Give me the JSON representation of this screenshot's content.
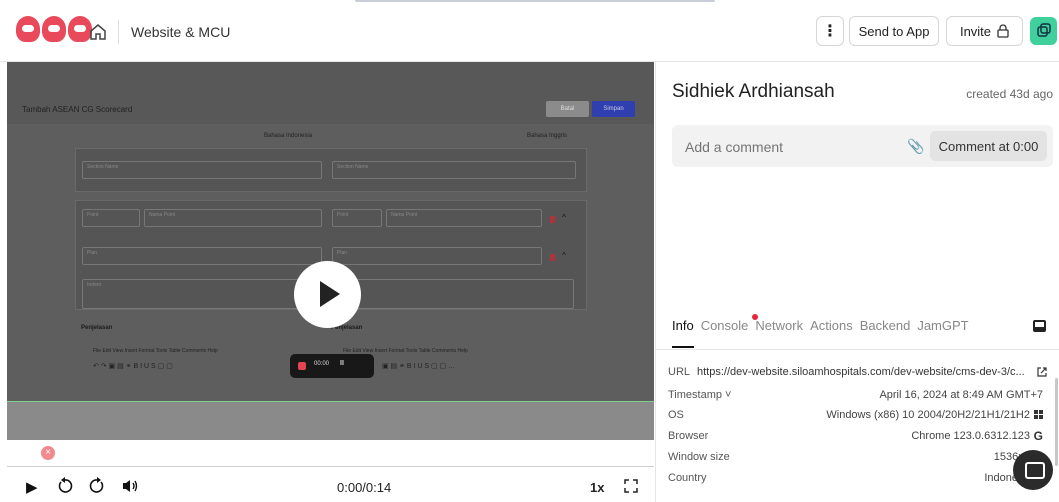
{
  "header": {
    "logo_text": "JAM",
    "project_name": "Website & MCU",
    "more_label": "⋮",
    "send_to_app_label": "Send to App",
    "invite_label": "Invite"
  },
  "video": {
    "page_title": "Tambah ASEAN CG Scorecard",
    "cancel_label": "Batal",
    "save_label": "Simpan",
    "lang_id": "Bahasa Indonesia",
    "lang_en": "Bahasa Inggris",
    "section_name": "Section Name",
    "point": "Point",
    "nama_point": "Nama Point",
    "plan": "Plan",
    "indent": "Indent",
    "penjelasan": "Penjelasan",
    "menu": "File  Edit  View  Insert  Format  Tools  Table  Comments  Help",
    "rec_time": "00:00"
  },
  "player": {
    "current_time": "0:00/0:14",
    "speed": "1x"
  },
  "session": {
    "author": "Sidhiek Ardhiansah",
    "created": "created 43d ago",
    "comment_placeholder": "Add a comment",
    "comment_button": "Comment at 0:00"
  },
  "tabs": [
    "Info",
    "Console",
    "Network",
    "Actions",
    "Backend",
    "JamGPT"
  ],
  "info": {
    "url_label": "URL",
    "url_value": "https://dev-website.siloamhospitals.com/dev-website/cms-dev-3/c...",
    "timestamp_label": "Timestamp ˅",
    "timestamp_value": "April 16, 2024 at 8:49 AM GMT+7",
    "os_label": "OS",
    "os_value": "Windows (x86) 10 2004/20H2/21H1/21H2",
    "browser_label": "Browser",
    "browser_value": "Chrome 123.0.6312.123",
    "window_label": "Window size",
    "window_value": "1536x73",
    "country_label": "Country",
    "country_value": "Indone"
  },
  "colors": {
    "brand": "#e8495b",
    "accent_green": "#3fd09c",
    "badge_red": "#e4283e"
  }
}
